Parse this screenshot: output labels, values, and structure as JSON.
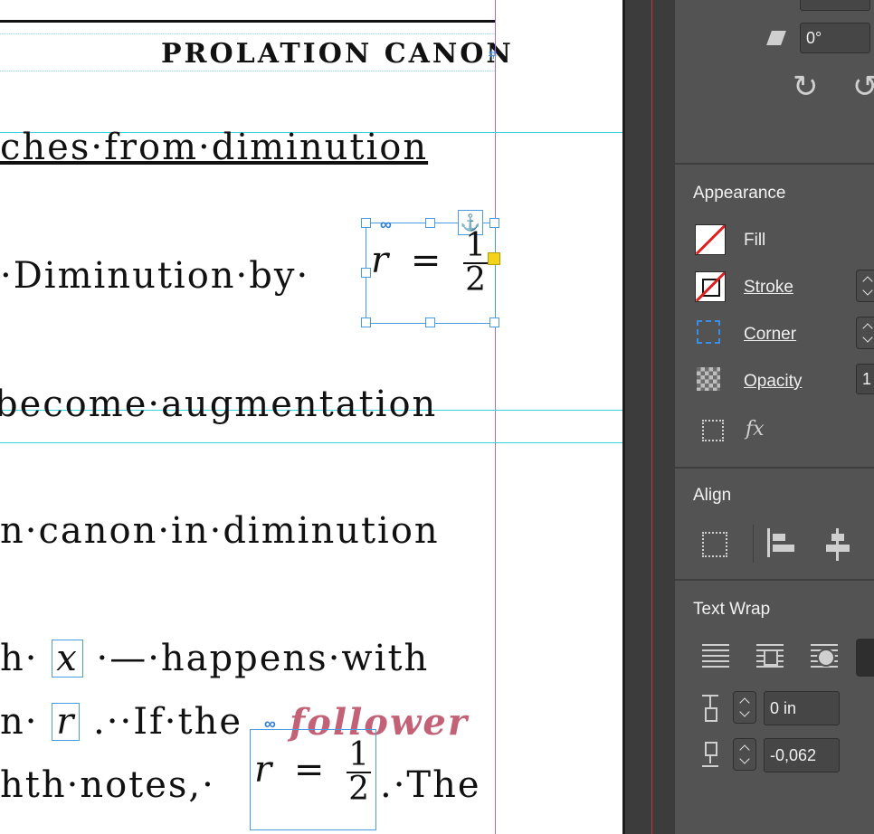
{
  "document": {
    "running_head": "PROLATION CANON",
    "lines": [
      "ches·from·diminution",
      "·Diminution·by·",
      "become·augmentation",
      "n·canon·in·diminution",
      "h·",
      "·—·happens·with",
      "n·",
      ".··If·the",
      "follower",
      "hth·notes,·",
      ".·The"
    ],
    "math": {
      "r": "r",
      "x": "x",
      "equals": "=",
      "half_num": "1",
      "half_den": "2"
    }
  },
  "panel": {
    "rotate_value": "0°",
    "appearance": {
      "title": "Appearance",
      "fill_label": "Fill",
      "stroke_label": "Stroke",
      "corner_label": "Corner",
      "opacity_label": "Opacity",
      "opacity_value": "1",
      "fx_label": "fx"
    },
    "align": {
      "title": "Align"
    },
    "text_wrap": {
      "title": "Text Wrap",
      "top_offset": "0 in",
      "bottom_offset": "-0,062"
    }
  }
}
